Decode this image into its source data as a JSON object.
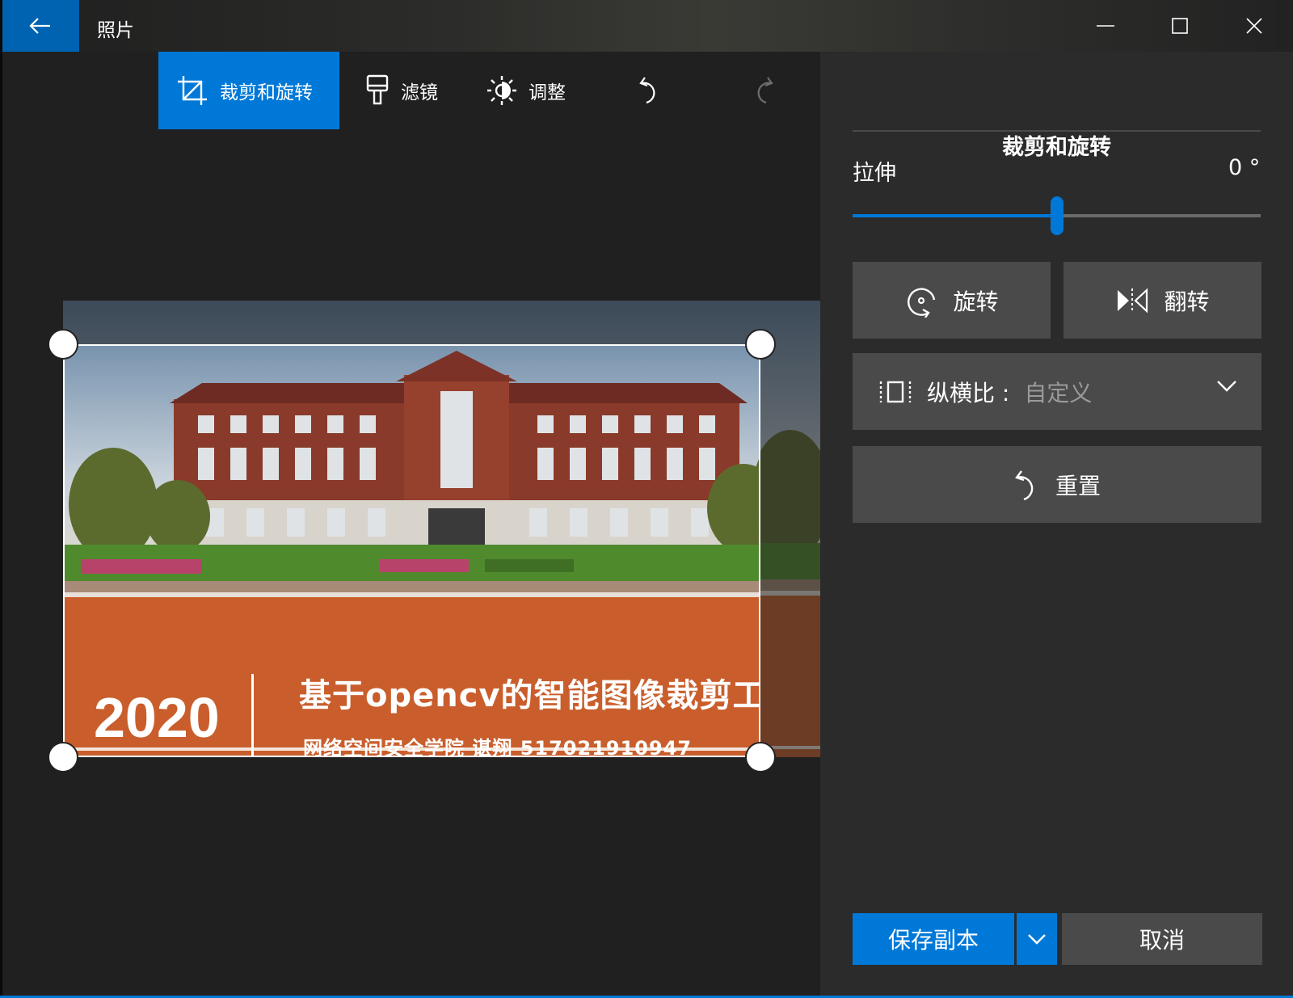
{
  "window": {
    "title": "照片",
    "buttons": [
      "minimize",
      "maximize",
      "close"
    ]
  },
  "toolbar": {
    "crop_label": "裁剪和旋转",
    "filter_label": "滤镜",
    "adjust_label": "调整",
    "active_tool": "裁剪和旋转"
  },
  "photo": {
    "banner_year": "2020",
    "banner_title": "基于opencv的智能图像裁剪工具",
    "banner_subtitle": "网络空间安全学院 谌翔 517021910947"
  },
  "panel": {
    "title": "裁剪和旋转",
    "straighten_label": "拉伸",
    "straighten_value": "0 °",
    "straighten_fraction": 0.5,
    "rotate_label": "旋转",
    "flip_label": "翻转",
    "aspect_label": "纵横比 :",
    "aspect_value": "自定义",
    "reset_label": "重置",
    "save_label": "保存副本",
    "cancel_label": "取消"
  },
  "colors": {
    "accent": "#0078d7",
    "title_back": "#0063b1",
    "panel_bg": "#2b2b2b",
    "button_bg": "#4a4a4a",
    "banner_orange": "#c95e2c"
  }
}
